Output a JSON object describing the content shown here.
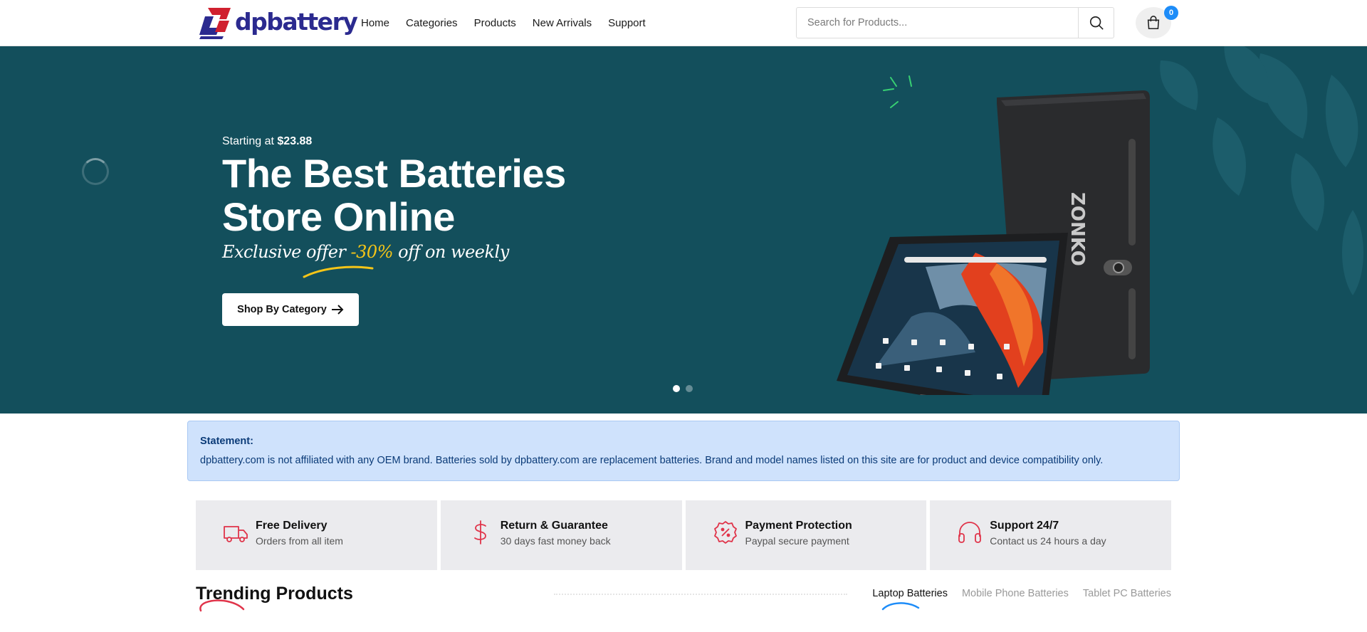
{
  "header": {
    "logo_text": "dpbattery",
    "nav": [
      "Home",
      "Categories",
      "Products",
      "New Arrivals",
      "Support"
    ],
    "search_placeholder": "Search for Products...",
    "cart_count": "0"
  },
  "hero": {
    "eyebrow_prefix": "Starting at",
    "eyebrow_price": "$23.88",
    "title_line1": "The Best Batteries",
    "title_line2": "Store Online",
    "offer_prefix": "Exclusive offer",
    "offer_pct": "-30%",
    "offer_suffix": "off on weekly",
    "cta_label": "Shop By Category",
    "slides_total": 2,
    "slide_active": 1,
    "device_brand": "ZONKO"
  },
  "statement": {
    "title": "Statement:",
    "text": "dpbattery.com is not affiliated with any OEM brand. Batteries sold by dpbattery.com are replacement batteries. Brand and model names listed on this site are for product and device compatibility only."
  },
  "features": [
    {
      "title": "Free Delivery",
      "subtitle": "Orders from all item",
      "icon": "truck-icon"
    },
    {
      "title": "Return & Guarantee",
      "subtitle": "30 days fast money back",
      "icon": "dollar-icon"
    },
    {
      "title": "Payment Protection",
      "subtitle": "Paypal secure payment",
      "icon": "percent-badge-icon"
    },
    {
      "title": "Support 24/7",
      "subtitle": "Contact us 24 hours a day",
      "icon": "headphones-icon"
    }
  ],
  "trending": {
    "title": "Trending Products",
    "tabs": [
      "Laptop Batteries",
      "Mobile Phone Batteries",
      "Tablet PC Batteries"
    ],
    "active_tab": 0
  },
  "colors": {
    "hero_bg": "#134f5c",
    "accent_red": "#e0344a",
    "brand_blue": "#2b2a8f",
    "badge_blue": "#1d8cf8",
    "offer_yellow": "#f5c518"
  }
}
